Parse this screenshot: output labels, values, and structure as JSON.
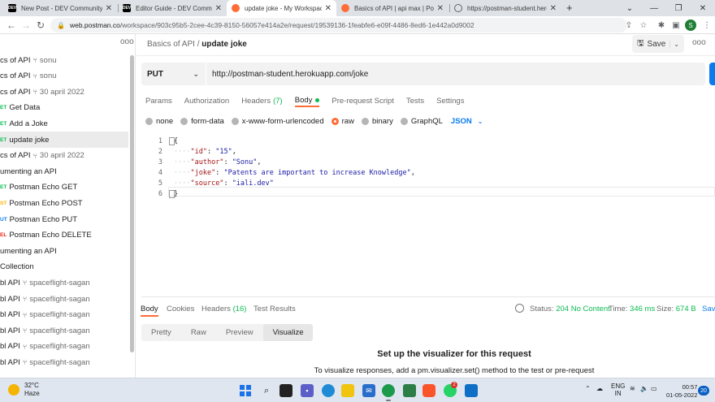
{
  "browser": {
    "tabs": [
      {
        "title": "New Post - DEV Community 🔒 🔒",
        "favicon": "DEV",
        "color": "#000000"
      },
      {
        "title": "Editor Guide - DEV Community 🔒",
        "favicon": "DEV",
        "color": "#000000"
      },
      {
        "title": "update joke - My Workspace",
        "favicon": "",
        "color": "#ff6c37"
      },
      {
        "title": "Basics of API | api max | Postman",
        "favicon": "",
        "color": "#ff6c37"
      },
      {
        "title": "https://postman-student.herokua...",
        "favicon": "",
        "color": "#5f6368"
      }
    ],
    "new_tab": "+",
    "address_host": "web.postman.co",
    "address_path": "/workspace/903c95b5-2cee-4c39-8150-56057e414a2e/request/19539136-1feabfe6-e09f-4486-8ed6-1e442a0d9002",
    "profile_initial": "S"
  },
  "sidebar": {
    "more": "ooo",
    "items": [
      {
        "text": "cs of API",
        "fork": "⑂",
        "sub": "sonu"
      },
      {
        "text": "cs of API",
        "fork": "⑂",
        "sub": "sonu"
      },
      {
        "text": "cs of API",
        "fork": "⑂",
        "sub": "30 april 2022"
      },
      {
        "method": "ET",
        "method_color": "#0cbb52",
        "text": "Get Data"
      },
      {
        "method": "ET",
        "method_color": "#0cbb52",
        "text": "Add a Joke"
      },
      {
        "method": "ET",
        "method_color": "#0cbb52",
        "text": "update joke",
        "selected": true
      },
      {
        "text": "cs of API",
        "fork": "⑂",
        "sub": "30 april 2022"
      },
      {
        "text": "umenting an API"
      },
      {
        "method": "ET",
        "method_color": "#0cbb52",
        "text": "Postman Echo GET"
      },
      {
        "method": "ST",
        "method_color": "#ffb400",
        "text": "Postman Echo POST"
      },
      {
        "method": "UT",
        "method_color": "#097bed",
        "text": "Postman Echo PUT"
      },
      {
        "method": "EL",
        "method_color": "#eb2013",
        "text": "Postman Echo DELETE"
      },
      {
        "text": "umenting an API"
      },
      {
        "text": " Collection"
      },
      {
        "text": "bl API",
        "fork": "⑂",
        "sub": "spaceflight-sagan"
      },
      {
        "text": "bl API",
        "fork": "⑂",
        "sub": "spaceflight-sagan"
      },
      {
        "text": "bl API",
        "fork": "⑂",
        "sub": "spaceflight-sagan"
      },
      {
        "text": "bl API",
        "fork": "⑂",
        "sub": "spaceflight-sagan"
      },
      {
        "text": "bl API",
        "fork": "⑂",
        "sub": "spaceflight-sagan"
      },
      {
        "text": "bl API",
        "fork": "⑂",
        "sub": "spaceflight-sagan"
      }
    ]
  },
  "header": {
    "breadcrumb_parent": "Basics of API",
    "breadcrumb_sep": "/",
    "breadcrumb_current": "update joke",
    "save_label": "Save",
    "more": "ooo"
  },
  "request": {
    "method": "PUT",
    "url": "http://postman-student.herokuapp.com/joke",
    "tabs": [
      {
        "label": "Params"
      },
      {
        "label": "Authorization"
      },
      {
        "label": "Headers",
        "count": "(7)"
      },
      {
        "label": "Body",
        "dot": true,
        "active": true
      },
      {
        "label": "Pre-request Script"
      },
      {
        "label": "Tests"
      },
      {
        "label": "Settings"
      }
    ],
    "body_types": [
      {
        "label": "none"
      },
      {
        "label": "form-data"
      },
      {
        "label": "x-www-form-urlencoded"
      },
      {
        "label": "raw",
        "selected": true
      },
      {
        "label": "binary"
      },
      {
        "label": "GraphQL"
      }
    ],
    "language": "JSON",
    "code_lines": [
      {
        "n": "1",
        "text": "{"
      },
      {
        "n": "2",
        "key": "\"id\"",
        "value": "\"15\"",
        "trail": ","
      },
      {
        "n": "3",
        "key": "\"author\"",
        "value": "\"Sonu\"",
        "trail": ","
      },
      {
        "n": "4",
        "key": "\"joke\"",
        "value": "\"Patents are important to increase Knowledge\"",
        "trail": ","
      },
      {
        "n": "5",
        "key": "\"source\"",
        "value": "\"iali.dev\"",
        "trail": ""
      },
      {
        "n": "6",
        "text": "}"
      }
    ]
  },
  "response": {
    "tabs": [
      {
        "label": "Body",
        "active": true
      },
      {
        "label": "Cookies"
      },
      {
        "label": "Headers",
        "count": "(16)"
      },
      {
        "label": "Test Results"
      }
    ],
    "status_label": "Status:",
    "status_value": "204 No Content",
    "time_label": "Time:",
    "time_value": "346 ms",
    "size_label": "Size:",
    "size_value": "674 B",
    "save_label": "Sav",
    "view_tabs": [
      {
        "label": "Pretty"
      },
      {
        "label": "Raw"
      },
      {
        "label": "Preview"
      },
      {
        "label": "Visualize",
        "active": true
      }
    ],
    "viz_title": "Set up the visualizer for this request",
    "viz_desc": "To visualize responses, add a pm.visualizer.set() method to the test or pre-request"
  },
  "taskbar": {
    "temp": "32°C",
    "condition": "Haze",
    "lang_line1": "ENG",
    "lang_line2": "IN",
    "time": "00:57",
    "date": "01-05-2022",
    "notifications": "20",
    "badge_count": "2"
  }
}
